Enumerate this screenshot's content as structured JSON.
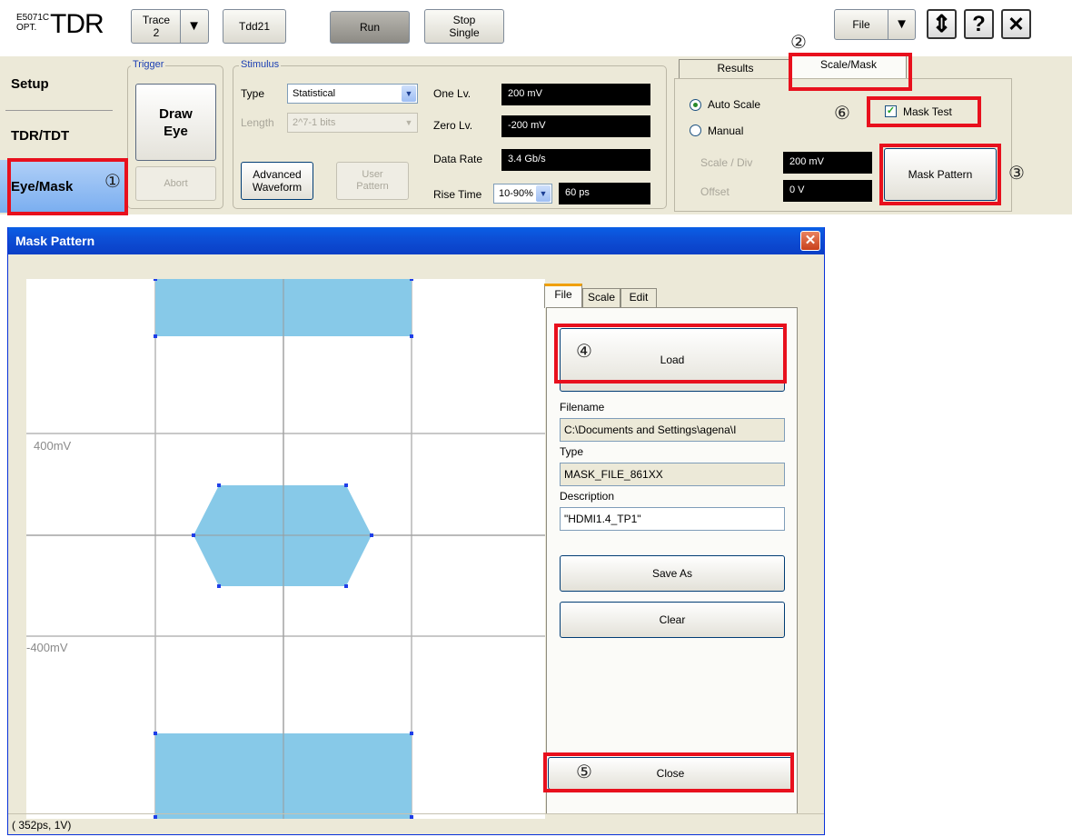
{
  "toolbar": {
    "logo_small_1": "E5071C",
    "logo_small_2": "OPT.",
    "logo_big": "TDR",
    "trace_label": "Trace",
    "trace_value": "2",
    "tdd_label": "Tdd21",
    "run_label": "Run",
    "stop_label_1": "Stop",
    "stop_label_2": "Single",
    "file_label": "File",
    "updown_glyph": "⇕",
    "help_glyph": "?",
    "close_glyph": "✕"
  },
  "sidebar": {
    "items": [
      {
        "label": "Setup"
      },
      {
        "label": "TDR/TDT"
      },
      {
        "label": "Eye/Mask"
      }
    ]
  },
  "trigger": {
    "group_label": "Trigger",
    "draw_eye_1": "Draw",
    "draw_eye_2": "Eye",
    "abort": "Abort"
  },
  "stimulus": {
    "group_label": "Stimulus",
    "type_label": "Type",
    "type_value": "Statistical",
    "length_label": "Length",
    "length_value": "2^7-1 bits",
    "advanced_1": "Advanced",
    "advanced_2": "Waveform",
    "user_1": "User",
    "user_2": "Pattern",
    "one_lv_label": "One Lv.",
    "one_lv_value": "200 mV",
    "zero_lv_label": "Zero Lv.",
    "zero_lv_value": "-200 mV",
    "data_rate_label": "Data Rate",
    "data_rate_value": "3.4 Gb/s",
    "rise_time_label": "Rise Time",
    "rise_time_select": "10-90%",
    "rise_time_value": "60 ps"
  },
  "results_panel": {
    "tab_results": "Results",
    "tab_scale_mask": "Scale/Mask",
    "auto_scale": "Auto Scale",
    "manual": "Manual",
    "scale_div_label": "Scale / Div",
    "scale_div_value": "200 mV",
    "offset_label": "Offset",
    "offset_value": "0 V",
    "mask_test": "Mask Test",
    "mask_test_checked": true,
    "mask_pattern": "Mask Pattern"
  },
  "callouts": {
    "n1": "①",
    "n2": "②",
    "n3": "③",
    "n4": "④",
    "n5": "⑤",
    "n6": "⑥"
  },
  "dialog": {
    "title": "Mask Pattern",
    "close_glyph": "✕",
    "plot": {
      "label_top": "400mV",
      "label_bottom": "-400mV"
    },
    "tabs": [
      "File",
      "Scale",
      "Edit"
    ],
    "load": "Load",
    "filename_label": "Filename",
    "filename_value": "C:\\Documents and Settings\\agena\\I",
    "type_label": "Type",
    "type_value": "MASK_FILE_861XX",
    "description_label": "Description",
    "description_value": "\"HDMI1.4_TP1\"",
    "save_as": "Save As",
    "clear": "Clear",
    "close": "Close",
    "status": "( 352ps,  1V)"
  },
  "colors": {
    "highlight": "#e8101d",
    "mask_fill": "#87c9e8",
    "title_bar": "#0a5fe6",
    "panel_bg": "#ece9d8"
  }
}
